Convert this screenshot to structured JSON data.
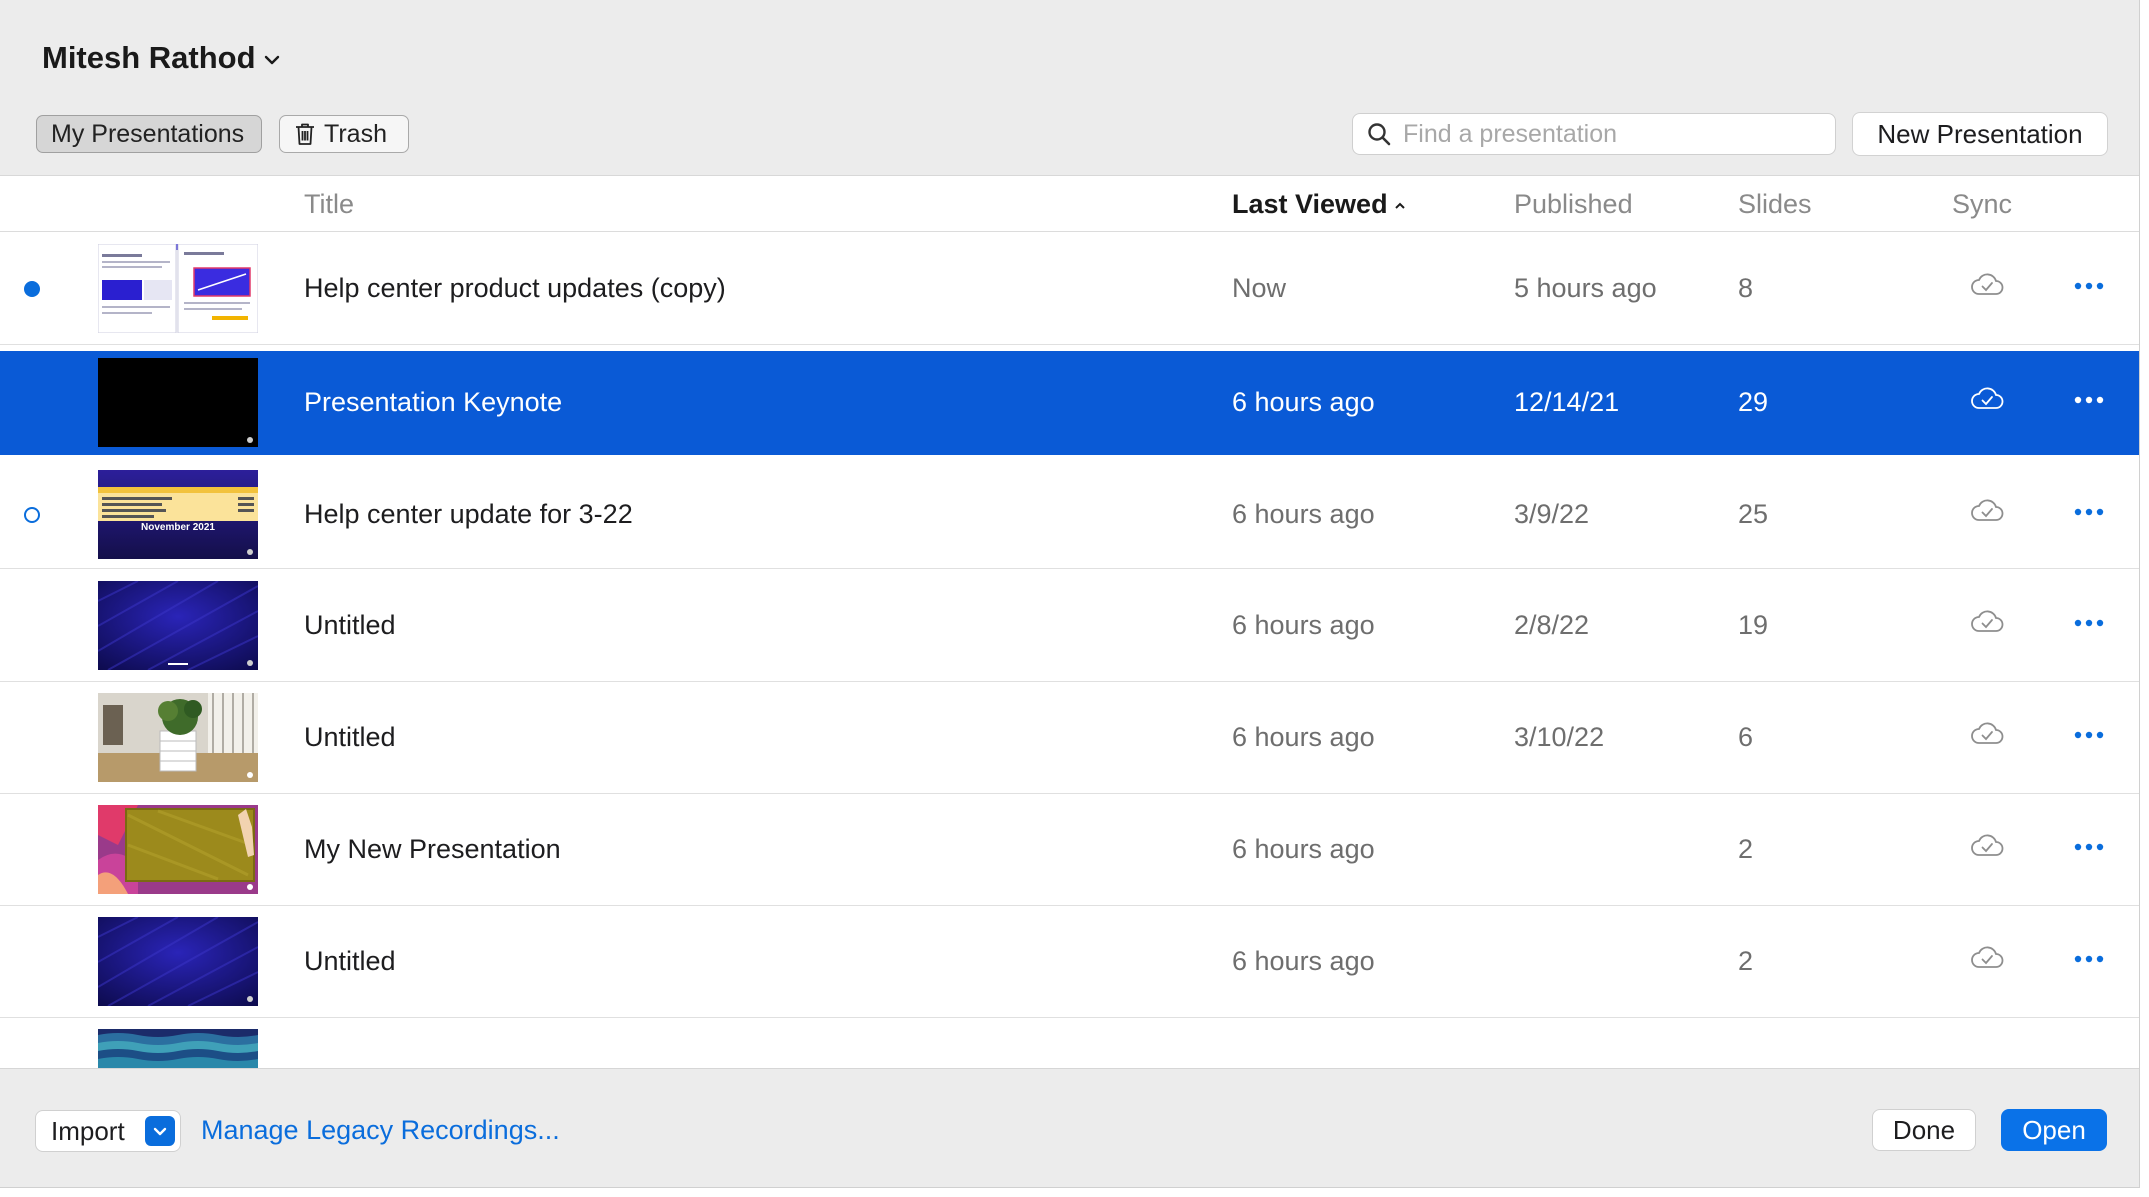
{
  "account": {
    "name": "Mitesh Rathod"
  },
  "tabs": {
    "my_presentations": "My Presentations",
    "trash": "Trash"
  },
  "search": {
    "placeholder": "Find a presentation",
    "value": ""
  },
  "new_presentation_label": "New Presentation",
  "columns": {
    "title": "Title",
    "last_viewed": "Last Viewed",
    "published": "Published",
    "slides": "Slides",
    "sync": "Sync"
  },
  "sort": {
    "column": "Last Viewed",
    "direction": "ascending"
  },
  "rows": [
    {
      "title": "Help center product updates (copy)",
      "last_viewed": "Now",
      "published": "5 hours ago",
      "slides": "8",
      "indicator": "filled-dot",
      "selected": false
    },
    {
      "title": "Presentation Keynote",
      "last_viewed": "6 hours ago",
      "published": "12/14/21",
      "slides": "29",
      "indicator": "none",
      "selected": true
    },
    {
      "title": "Help center update for 3-22",
      "last_viewed": "6 hours ago",
      "published": "3/9/22",
      "slides": "25",
      "indicator": "hollow-dot",
      "selected": false,
      "thumb_text": "November 2021"
    },
    {
      "title": "Untitled",
      "last_viewed": "6 hours ago",
      "published": "2/8/22",
      "slides": "19",
      "indicator": "none",
      "selected": false
    },
    {
      "title": "Untitled",
      "last_viewed": "6 hours ago",
      "published": "3/10/22",
      "slides": "6",
      "indicator": "none",
      "selected": false
    },
    {
      "title": "My New Presentation",
      "last_viewed": "6 hours ago",
      "published": "",
      "slides": "2",
      "indicator": "none",
      "selected": false
    },
    {
      "title": "Untitled",
      "last_viewed": "6 hours ago",
      "published": "",
      "slides": "2",
      "indicator": "none",
      "selected": false
    }
  ],
  "footer": {
    "import_label": "Import",
    "manage_label": "Manage Legacy Recordings...",
    "done_label": "Done",
    "open_label": "Open"
  },
  "colors": {
    "accent": "#0a6ddc",
    "selection": "#0a5ad6",
    "window_bg": "#ececec"
  },
  "icons": [
    "chevron-down-icon",
    "trash-icon",
    "search-icon",
    "sort-ascending-icon",
    "cloud-check-icon",
    "more-icon"
  ]
}
